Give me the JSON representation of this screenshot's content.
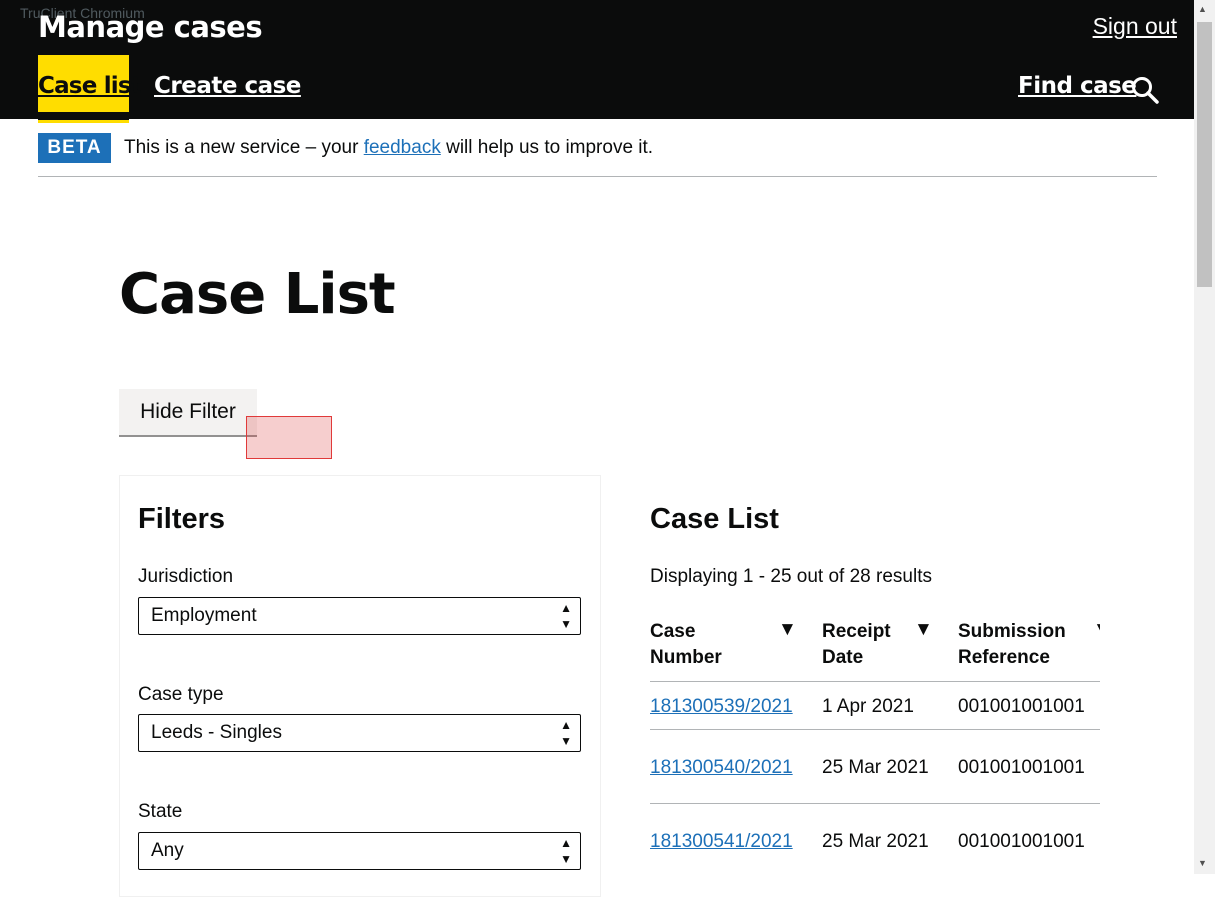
{
  "browser": {
    "watermark": "TruClient Chromium"
  },
  "header": {
    "service_name": "Manage cases",
    "sign_out": "Sign out",
    "nav": {
      "case_list": "Case list",
      "create_case": "Create case",
      "find_case": "Find case"
    }
  },
  "beta": {
    "tag": "BETA",
    "text_before": "This is a new service – your ",
    "link": "feedback",
    "text_after": " will help us to improve it."
  },
  "page_title": "Case List",
  "hide_filter": "Hide Filter",
  "filters": {
    "heading": "Filters",
    "jurisdiction": {
      "label": "Jurisdiction",
      "value": "Employment"
    },
    "case_type": {
      "label": "Case type",
      "value": "Leeds - Singles"
    },
    "state": {
      "label": "State",
      "value": "Any"
    }
  },
  "results": {
    "heading": "Case List",
    "displaying": "Displaying 1 - 25 out of 28 results",
    "columns": [
      {
        "line1": "Case",
        "line2": "Number"
      },
      {
        "line1": "Receipt",
        "line2": "Date"
      },
      {
        "line1": "Submission",
        "line2": "Reference"
      }
    ],
    "sort_glyph": "▼",
    "rows": [
      {
        "case_number": "181300539/2021",
        "receipt_date": "1 Apr 2021",
        "submission_reference": "001001001001"
      },
      {
        "case_number": "181300540/2021",
        "receipt_date": "25 Mar 2021",
        "submission_reference": "001001001001"
      },
      {
        "case_number": "181300541/2021",
        "receipt_date": "25 Mar 2021",
        "submission_reference": "001001001001"
      }
    ]
  }
}
